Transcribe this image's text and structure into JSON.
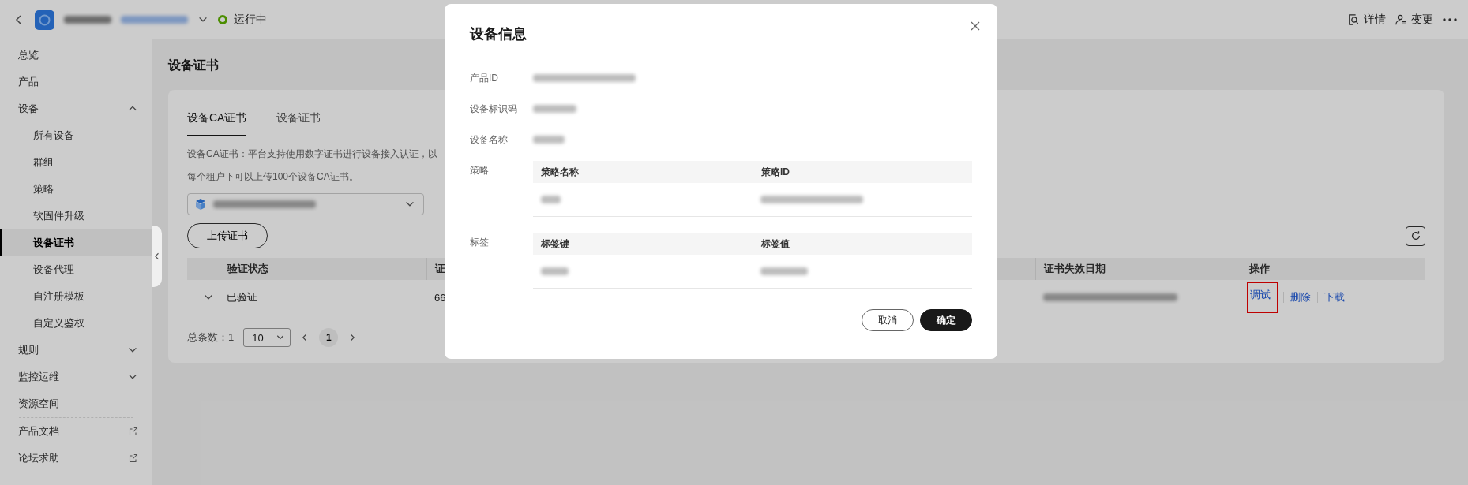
{
  "header": {
    "status": "运行中",
    "actions": [
      {
        "kind": "details",
        "label": "详情"
      },
      {
        "kind": "change",
        "label": "变更"
      }
    ]
  },
  "sidebar": {
    "items": [
      {
        "kind": "item",
        "label": "总览",
        "selected": false
      },
      {
        "kind": "item",
        "label": "产品",
        "selected": false
      },
      {
        "kind": "group",
        "label": "设备",
        "selected": false,
        "expanded": true,
        "children": [
          {
            "label": "所有设备",
            "selected": false
          },
          {
            "label": "群组",
            "selected": false
          },
          {
            "label": "策略",
            "selected": false
          },
          {
            "label": "软固件升级",
            "selected": false
          },
          {
            "label": "设备证书",
            "selected": true
          },
          {
            "label": "设备代理",
            "selected": false
          },
          {
            "label": "自注册模板",
            "selected": false
          },
          {
            "label": "自定义鉴权",
            "selected": false
          }
        ]
      },
      {
        "kind": "group",
        "label": "规则",
        "selected": false,
        "expanded": false
      },
      {
        "kind": "group",
        "label": "监控运维",
        "selected": false,
        "expanded": false
      },
      {
        "kind": "item",
        "label": "资源空间",
        "selected": false
      },
      {
        "kind": "external",
        "label": "产品文档",
        "selected": false
      },
      {
        "kind": "external",
        "label": "论坛求助",
        "selected": false
      }
    ]
  },
  "page_title": "设备证书",
  "tabs": [
    {
      "label": "设备CA证书",
      "selected": true
    },
    {
      "label": "设备证书",
      "selected": false
    }
  ],
  "description": [
    "设备CA证书：平台支持使用数字证书进行设备接入认证，以",
    "每个租户下可以上传100个设备CA证书。"
  ],
  "upload_button": "上传证书",
  "table": {
    "columns": [
      "验证状态",
      "证",
      "证书失效日期",
      "操作"
    ],
    "rows": [
      {
        "expanded": false,
        "status": "已验证",
        "column_2": "66",
        "actions": [
          {
            "label": "调试",
            "highlighted": true
          },
          {
            "label": "删除",
            "highlighted": false
          },
          {
            "label": "下载",
            "highlighted": false
          }
        ]
      }
    ]
  },
  "pagination": {
    "total": "总条数：1",
    "page_size": "10",
    "pages": [
      {
        "label": "1",
        "selected": true
      }
    ]
  },
  "dialog": {
    "title": "设备信息",
    "fields": [
      {
        "kind": "value",
        "label": "产品ID"
      },
      {
        "kind": "value",
        "label": "设备标识码"
      },
      {
        "kind": "value",
        "label": "设备名称"
      },
      {
        "kind": "table",
        "label": "策略",
        "columns": [
          "策略名称",
          "策略ID"
        ]
      },
      {
        "kind": "table",
        "label": "标签",
        "columns": [
          "标签键",
          "标签值"
        ]
      }
    ],
    "buttons": [
      {
        "kind": "secondary",
        "label": "取消"
      },
      {
        "kind": "primary",
        "label": "确定"
      }
    ]
  }
}
